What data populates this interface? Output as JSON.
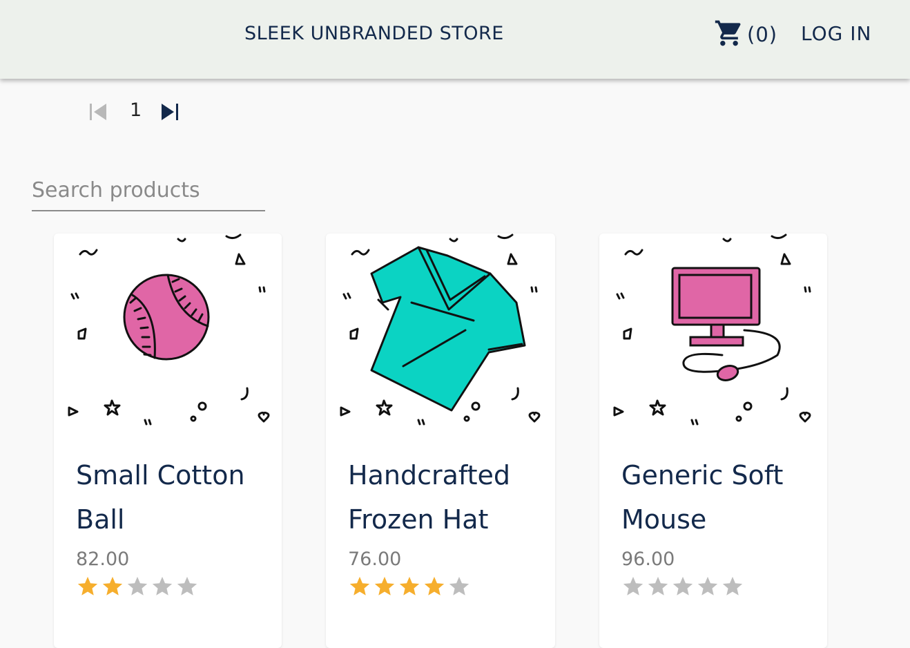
{
  "header": {
    "store_title": "SLEEK UNBRANDED STORE",
    "cart_count": "(0)",
    "login_label": "LOG IN",
    "cart_icon": "shopping-cart-icon"
  },
  "pagination": {
    "current_page": "1",
    "first_icon": "first-page-icon",
    "last_icon": "last-page-icon"
  },
  "search": {
    "placeholder": "Search products",
    "value": ""
  },
  "colors": {
    "header_bg": "#edf1ec",
    "brand_text": "#13294b",
    "star_filled": "#f6ae2d",
    "star_empty": "#bdbdbd",
    "pink": "#e066a6",
    "teal": "#0bd3c3"
  },
  "products": [
    {
      "name": "Small Cotton Ball",
      "price": "82.00",
      "rating": 2,
      "image": "baseball-illustration"
    },
    {
      "name": "Handcrafted Frozen Hat",
      "price": "76.00",
      "rating": 4,
      "image": "tshirt-illustration"
    },
    {
      "name": "Generic Soft Mouse",
      "price": "96.00",
      "rating": 0,
      "image": "computer-illustration"
    }
  ]
}
